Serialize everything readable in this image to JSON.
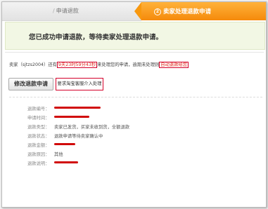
{
  "steps": {
    "step1_number": "/",
    "step1_label": "申请退款",
    "step2_number": "2",
    "step2_label": "卖家处理退款申请"
  },
  "notice": {
    "message": "您已成功申请退款，等待卖家处理退款申请。"
  },
  "seller_line": {
    "prefix": "卖家（",
    "seller_name": "sjtzs2004",
    "middle": "）还有",
    "time_remaining": "9天23时59分43秒",
    "after_time": "来处理您的申请，逾期未处理则",
    "auto_action": "自动退款给您"
  },
  "buttons": {
    "modify": "修改退款申请",
    "escalate": "要求淘宝客服介入处理"
  },
  "details": [
    {
      "label": "退款编号：",
      "value": ""
    },
    {
      "label": "申请时间：",
      "value": ""
    },
    {
      "label": "退款类型：",
      "value": "卖家已发货，买家未收到货，全额退款"
    },
    {
      "label": "退款状态：",
      "value": "退款申请等待卖家确认中"
    },
    {
      "label": "退款金额：",
      "value": ""
    },
    {
      "label": "退款原因：",
      "value": "其他"
    },
    {
      "label": "退款说明：",
      "value": ""
    }
  ],
  "colors": {
    "accent_orange": "#f58a0b",
    "highlight_red": "#d4002a",
    "notice_bg": "#f2f7e4"
  }
}
